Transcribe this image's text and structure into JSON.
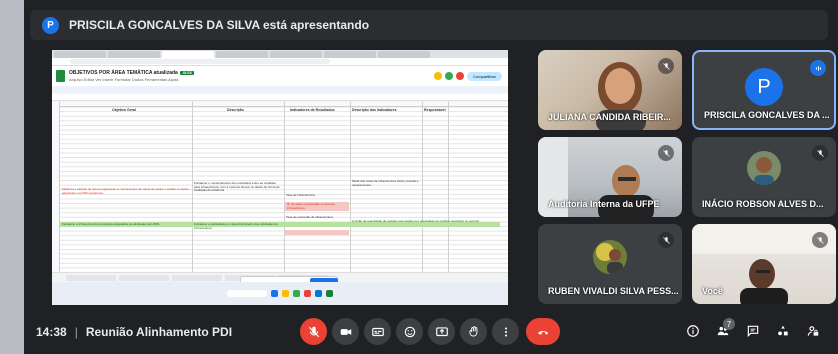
{
  "banner": {
    "avatar_letter": "P",
    "text": "PRISCILA GONCALVES DA SILVA está apresentando"
  },
  "shared_screen": {
    "doc_title": "OBJETIVOS POR ÁREA TEMÁTICA atualizada",
    "doc_menu": "Arquivo Editar Ver Inserir Formatar Dados Ferramentas Ajuda",
    "share_label": "Compartilhar",
    "columns": [
      "Objetivo Geral",
      "Descrição",
      "Indicadores de Resultados",
      "Descrição dos Indicadores",
      "Responsável"
    ],
    "cells": [
      "Melhorar e efetivar de forma organizada os instrumentos de coleta de dados e avaliar os dados adquiridos nos PDIs anteriores.",
      "Fortalecer o monitoramento dos resultados entre as unidades para infraestrutura, com a meta de buscar os dados de forma de avaliação de eficiência",
      "Taxa de infraestrutura",
      "Medir das notas de infraestrutura física, pessoal e equipamentos",
      "N° de ações executadas na área de infraestrutura",
      "Taxa de execução da infraestrutura",
      "Fortalecer a infraestrutura tecnológica adequadas às atividades da UFPE",
      "Fortalecer a efetividade e o desenvolvimento das atividades de infraestrutura",
      "A razão da quantidade de pedidos executados por quantidade de pedidos recebidos no período"
    ]
  },
  "participants": [
    {
      "name": "JULIANA CANDIDA RIBEIR...",
      "muted": true,
      "type": "video"
    },
    {
      "name": "PRISCILA GONCALVES DA ...",
      "muted": false,
      "speaking": true,
      "type": "avatar",
      "avatar_letter": "P"
    },
    {
      "name": "Auditoria Interna da UFPE",
      "muted": true,
      "type": "video"
    },
    {
      "name": "INÁCIO ROBSON ALVES D...",
      "muted": true,
      "type": "photo"
    },
    {
      "name": "RUBEN VIVALDI SILVA PESS...",
      "muted": true,
      "type": "photo"
    },
    {
      "name": "Você",
      "muted": true,
      "type": "video"
    }
  ],
  "bottom_bar": {
    "time": "14:38",
    "separator": "|",
    "meeting_title": "Reunião Alinhamento PDI",
    "participant_count": "7"
  },
  "colors": {
    "accent": "#1a73e8",
    "danger": "#ea4335",
    "background": "#202124",
    "control": "#3c4043"
  }
}
